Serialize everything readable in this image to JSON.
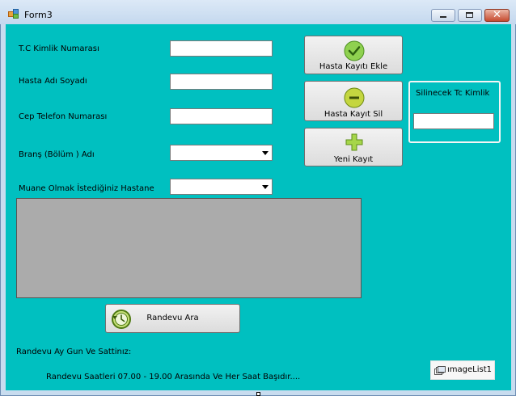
{
  "window": {
    "title": "Form3"
  },
  "form": {
    "tc_label": "T.C Kimlik Numarası",
    "tc_value": "",
    "name_label": "Hasta Adı Soyadı",
    "name_value": "",
    "phone_label": "Cep Telefon Numarası",
    "phone_value": "",
    "branch_label": "Branş (Bölüm ) Adı",
    "branch_value": "",
    "hospital_label": "Muane Olmak İstediğiniz Hastane",
    "hospital_value": ""
  },
  "buttons": {
    "add_label": "Hasta Kayıtı Ekle",
    "delete_label": "Hasta Kayıt Sil",
    "new_label": "Yeni Kayıt",
    "appointment_label": "Randevu Ara"
  },
  "delete_group": {
    "label": "Silinecek Tc Kimlik",
    "value": ""
  },
  "footer": {
    "date_label": "Randevu Ay Gun Ve Sattinız:",
    "info_text": "Randevu Saatleri 07.00 - 19.00 Arasında Ve Her Saat Başıdır...."
  },
  "component_tray": {
    "imagelist_label": "ımageList1"
  },
  "colors": {
    "client_background": "#00c0c0",
    "grid_background": "#ababab",
    "icon_green": "#7ac943"
  },
  "icons": [
    "checkmark-icon",
    "minus-icon",
    "plus-icon",
    "clock-arrow-icon",
    "imagelist-icon"
  ]
}
